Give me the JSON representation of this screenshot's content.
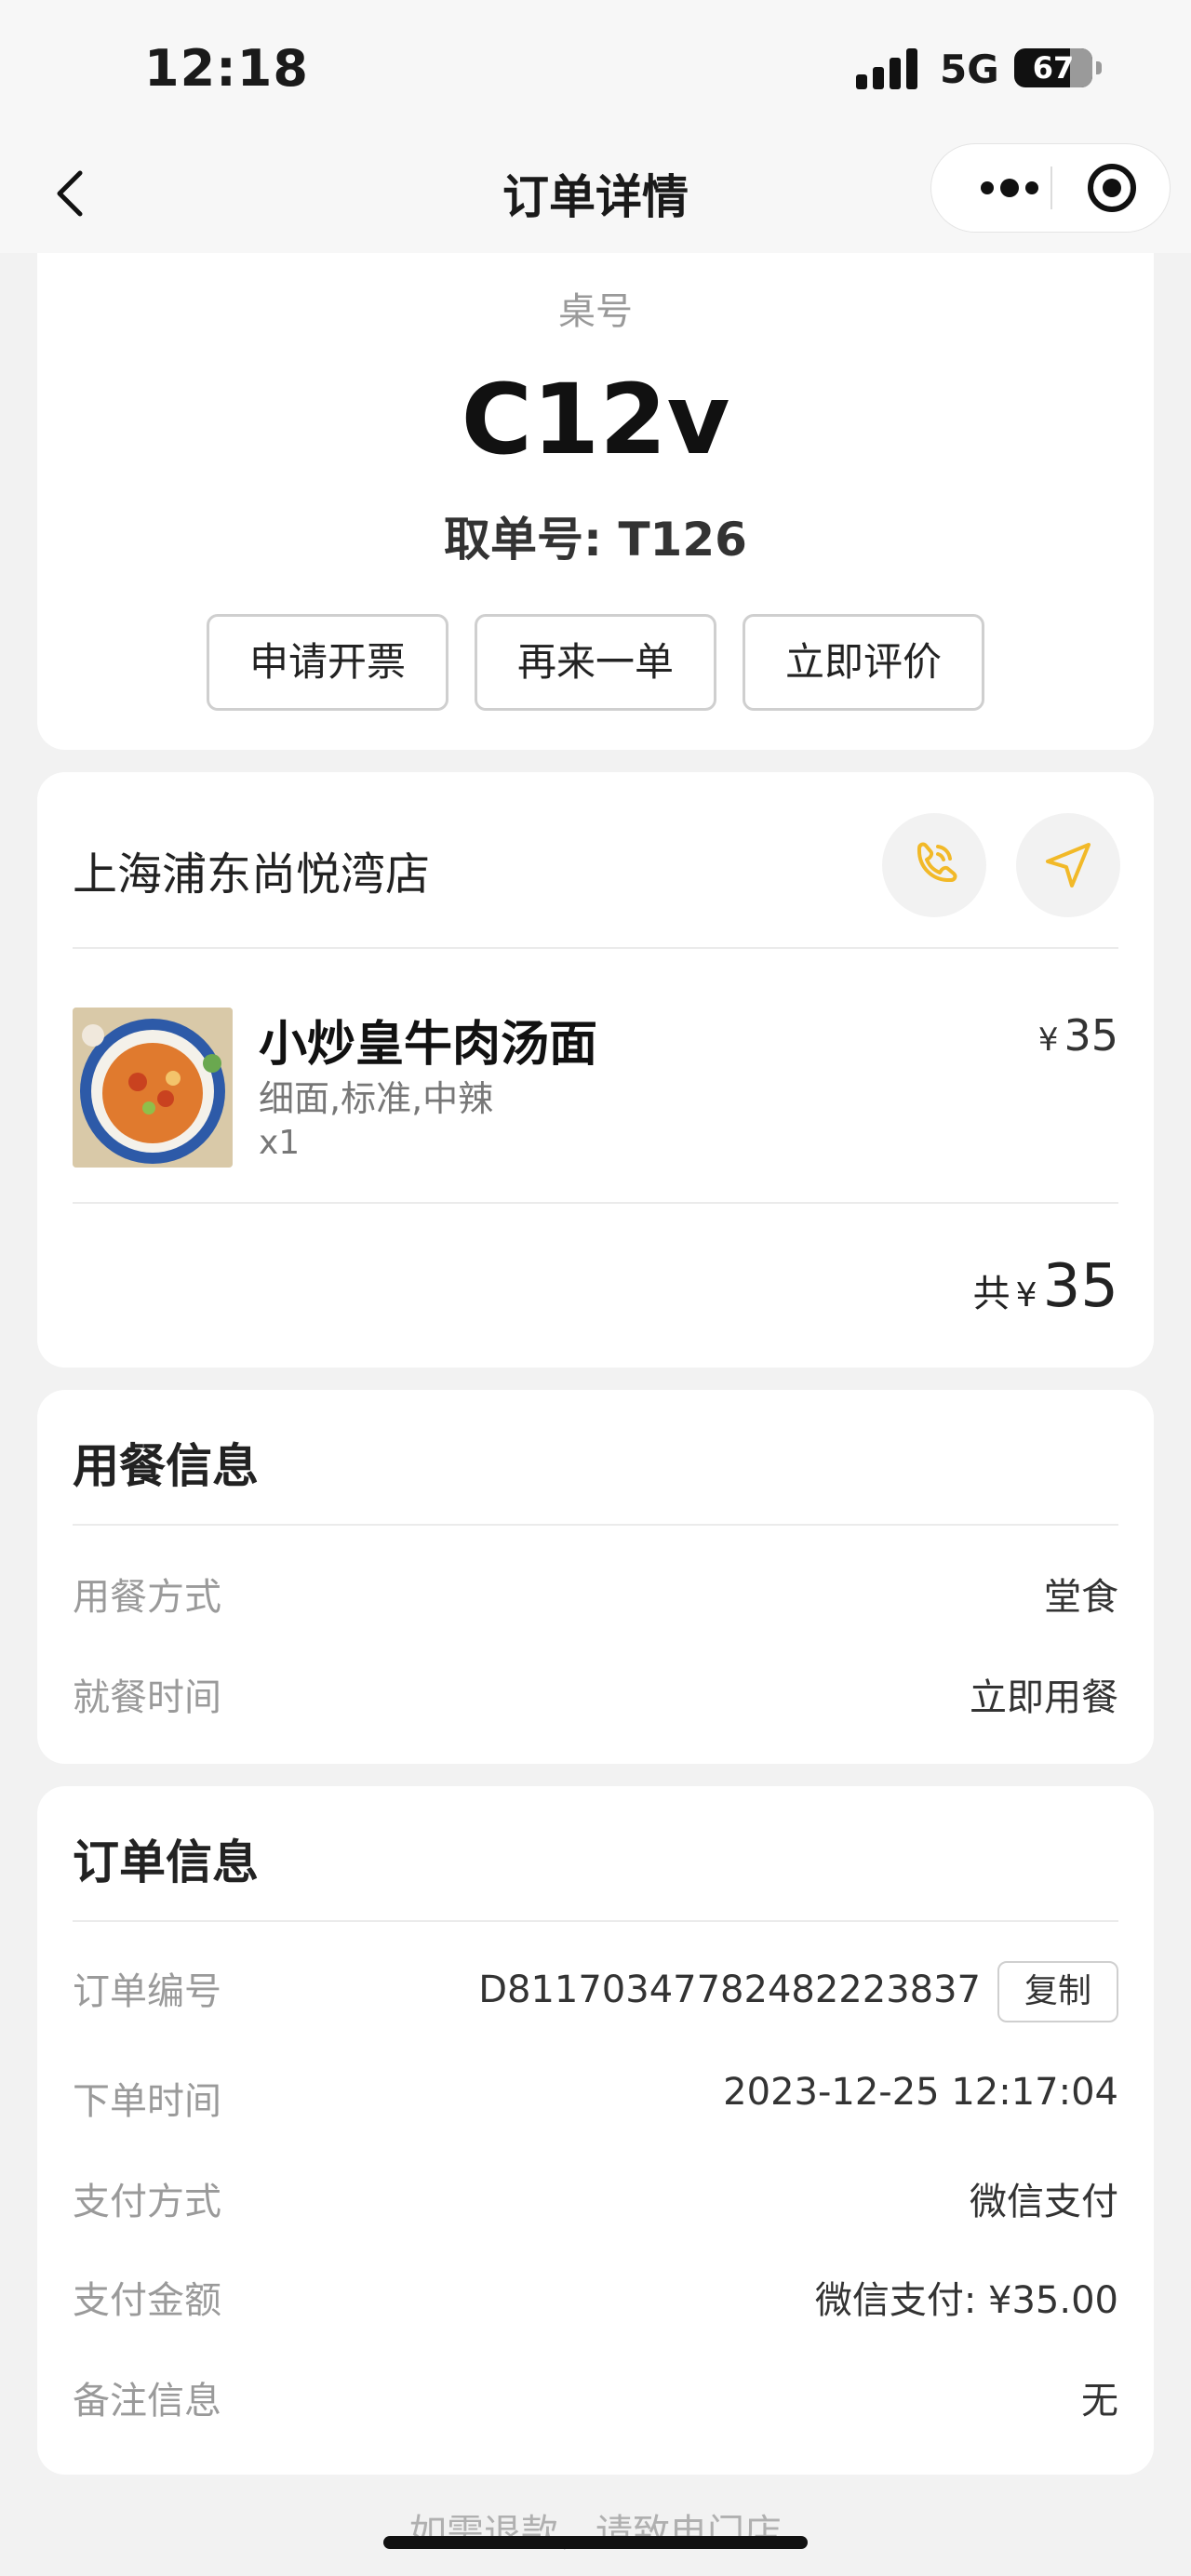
{
  "status_bar": {
    "time": "12:18",
    "network": "5G",
    "battery": "67"
  },
  "nav": {
    "title": "订单详情",
    "back_icon": "chevron-left-icon",
    "more_icon": "more-dots-icon",
    "close_icon": "target-circle-icon"
  },
  "order_header": {
    "table_label": "桌号",
    "table_number": "C12v",
    "pickup": "取单号: T126",
    "buttons": [
      "申请开票",
      "再来一单",
      "立即评价"
    ]
  },
  "store": {
    "name": "上海浦东尚悦湾店",
    "phone_icon": "phone-icon",
    "nav_icon": "navigation-arrow-icon",
    "accent": "#f2b928",
    "items": [
      {
        "name": "小炒皇牛肉汤面",
        "spec": "细面,标准,中辣",
        "qty": "x1",
        "currency": "¥",
        "price": "35"
      }
    ],
    "total_label": "共",
    "total_currency": "¥",
    "total_amount": "35"
  },
  "dining_info": {
    "title": "用餐信息",
    "rows": [
      {
        "label": "用餐方式",
        "value": "堂食"
      },
      {
        "label": "就餐时间",
        "value": "立即用餐"
      }
    ]
  },
  "order_info": {
    "title": "订单信息",
    "order_no_label": "订单编号",
    "order_no": "D81170347782482223837",
    "copy_label": "复制",
    "rows": [
      {
        "label": "下单时间",
        "value": "2023-12-25 12:17:04"
      },
      {
        "label": "支付方式",
        "value": "微信支付"
      },
      {
        "label": "支付金额",
        "value": "微信支付: ¥35.00"
      },
      {
        "label": "备注信息",
        "value": "无"
      }
    ]
  },
  "footer": {
    "note": "如需退款，请致电门店"
  }
}
